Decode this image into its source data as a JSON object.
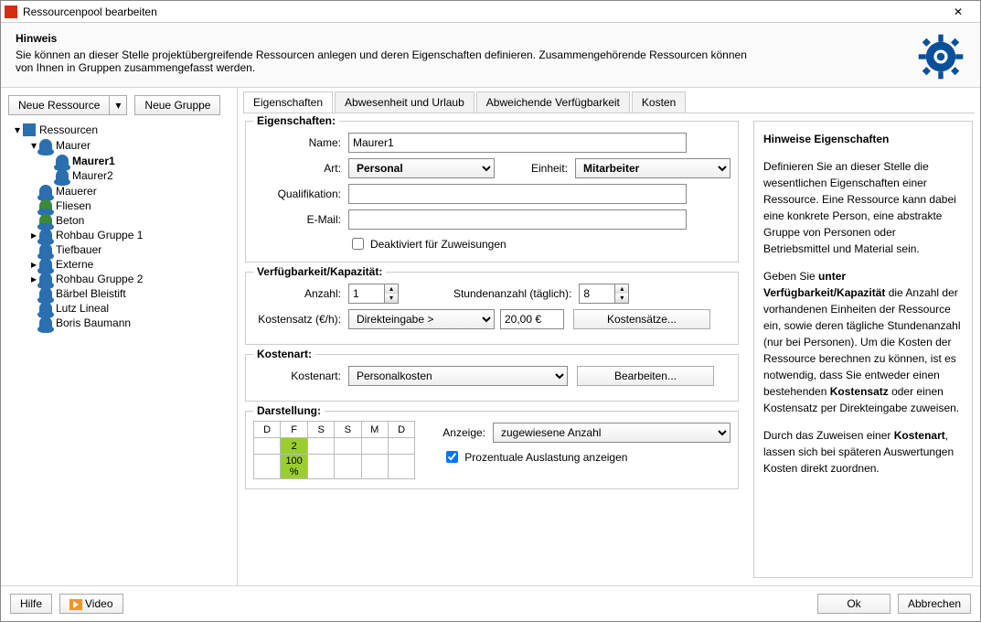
{
  "title": "Ressourcenpool bearbeiten",
  "header": {
    "heading": "Hinweis",
    "text": "Sie können an dieser Stelle projektübergreifende Ressourcen anlegen und deren Eigenschaften definieren. Zusammengehörende Ressourcen können von Ihnen in Gruppen zusammengefasst werden."
  },
  "toolbar": {
    "new_resource": "Neue Ressource",
    "new_group": "Neue Gruppe"
  },
  "tree": {
    "root": "Ressourcen",
    "maurer": "Maurer",
    "items": [
      "Maurer1",
      "Maurer2",
      "Mauerer",
      "Fliesen",
      "Beton",
      "Rohbau Gruppe 1",
      "Tiefbauer",
      "Externe",
      "Rohbau Gruppe 2",
      "Bärbel Bleistift",
      "Lutz Lineal",
      "Boris Baumann"
    ]
  },
  "tabs": [
    "Eigenschaften",
    "Abwesenheit und Urlaub",
    "Abweichende Verfügbarkeit",
    "Kosten"
  ],
  "form": {
    "section_props": "Eigenschaften:",
    "lbl_name": "Name:",
    "val_name": "Maurer1",
    "lbl_art": "Art:",
    "val_art": "Personal",
    "lbl_einheit": "Einheit:",
    "val_einheit": "Mitarbeiter",
    "lbl_qual": "Qualifikation:",
    "val_qual": "",
    "lbl_email": "E-Mail:",
    "val_email": "",
    "chk_deakt": "Deaktiviert für Zuweisungen",
    "section_cap": "Verfügbarkeit/Kapazität:",
    "lbl_anzahl": "Anzahl:",
    "val_anzahl": "1",
    "lbl_stunden": "Stundenanzahl (täglich):",
    "val_stunden": "8",
    "lbl_kostensatz": "Kostensatz (€/h):",
    "val_kostensatz_mode": "Direkteingabe >",
    "val_kostensatz": "20,00 €",
    "btn_kostensaetze": "Kostensätze...",
    "section_kostenart": "Kostenart:",
    "lbl_kostenart": "Kostenart:",
    "val_kostenart": "Personalkosten",
    "btn_bearbeiten": "Bearbeiten...",
    "section_darst": "Darstellung:",
    "tbl_head": [
      "D",
      "F",
      "S",
      "S",
      "M",
      "D"
    ],
    "cell_top": "2",
    "cell_bot": "100 %",
    "lbl_anzeige": "Anzeige:",
    "val_anzeige": "zugewiesene Anzahl",
    "chk_prozent": "Prozentuale Auslastung anzeigen"
  },
  "help": {
    "title": "Hinweise Eigenschaften",
    "p1a": "Definieren Sie an dieser Stelle die wesentlichen Eigenschaften einer Ressource. Eine Ressource kann dabei eine konkrete Person, eine abstrakte Gruppe von Personen oder Betriebsmittel und Material sein.",
    "p2a": "Geben Sie ",
    "p2b": "unter Verfügbarkeit/Kapazität",
    "p2c": " die Anzahl der vorhandenen Einheiten der Ressource ein, sowie deren tägliche Stundenanzahl (nur bei Personen). Um die Kosten der Ressource berechnen zu können, ist es notwendig, dass Sie entweder einen bestehenden ",
    "p2d": "Kostensatz",
    "p2e": " oder einen Kostensatz per Direkteingabe zuweisen.",
    "p3a": "Durch das Zuweisen einer ",
    "p3b": "Kostenart",
    "p3c": ", lassen sich bei späteren Auswertungen Kosten direkt zuordnen."
  },
  "footer": {
    "help": "Hilfe",
    "video": "Video",
    "ok": "Ok",
    "cancel": "Abbrechen"
  }
}
